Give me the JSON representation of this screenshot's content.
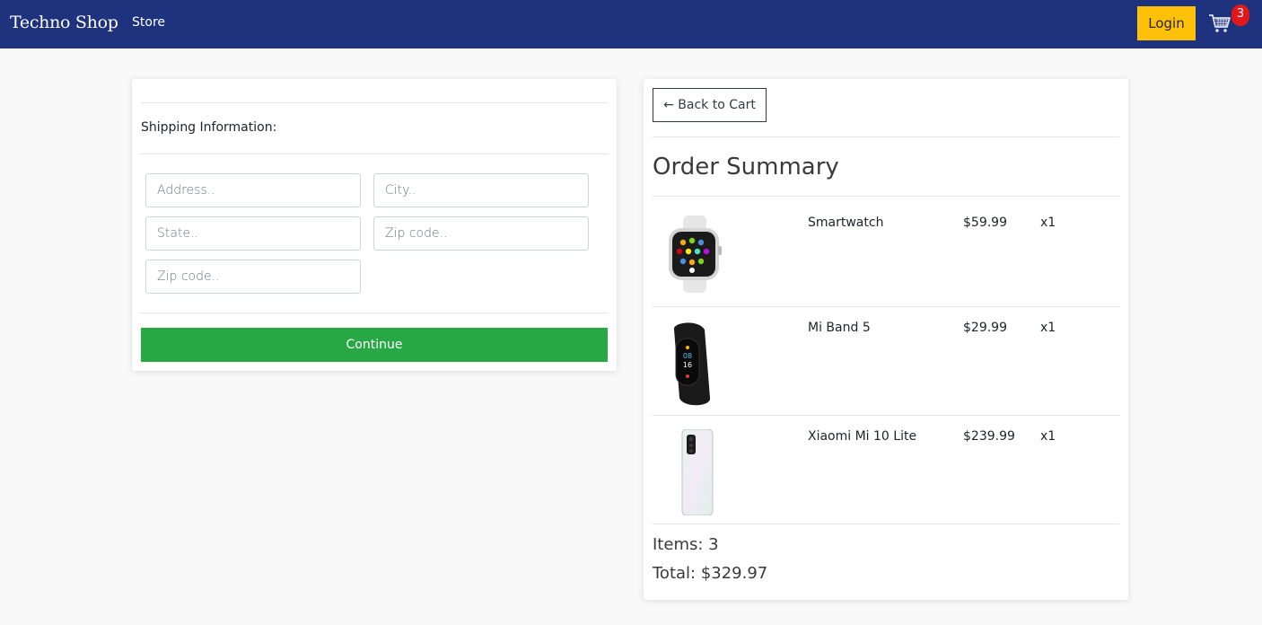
{
  "navbar": {
    "brand": "Techno Shop",
    "store_link": "Store",
    "login_label": "Login",
    "cart_count": "3",
    "cart_icon": "shopping-cart-icon",
    "bg_color": "#1e327d",
    "login_color": "#ffc107",
    "badge_color": "#e0171b"
  },
  "form": {
    "shipping_label": "Shipping Information:",
    "fields": {
      "address": "Address..",
      "city": "City..",
      "state": "State..",
      "zip": "Zip code..",
      "zip2": "Zip code.."
    },
    "continue_label": "Continue",
    "continue_color": "#28a745"
  },
  "summary": {
    "back_label": "← Back to Cart",
    "title": "Order Summary",
    "items": [
      {
        "name": "Smartwatch",
        "price": "$59.99",
        "qty": "x1",
        "image": "smartwatch-image"
      },
      {
        "name": "Mi Band 5",
        "price": "$29.99",
        "qty": "x1",
        "image": "fitness-band-image"
      },
      {
        "name": "Xiaomi Mi 10 Lite",
        "price": "$239.99",
        "qty": "x1",
        "image": "smartphone-image"
      }
    ],
    "items_count": "Items:   3",
    "total": "Total:   $329.97"
  }
}
